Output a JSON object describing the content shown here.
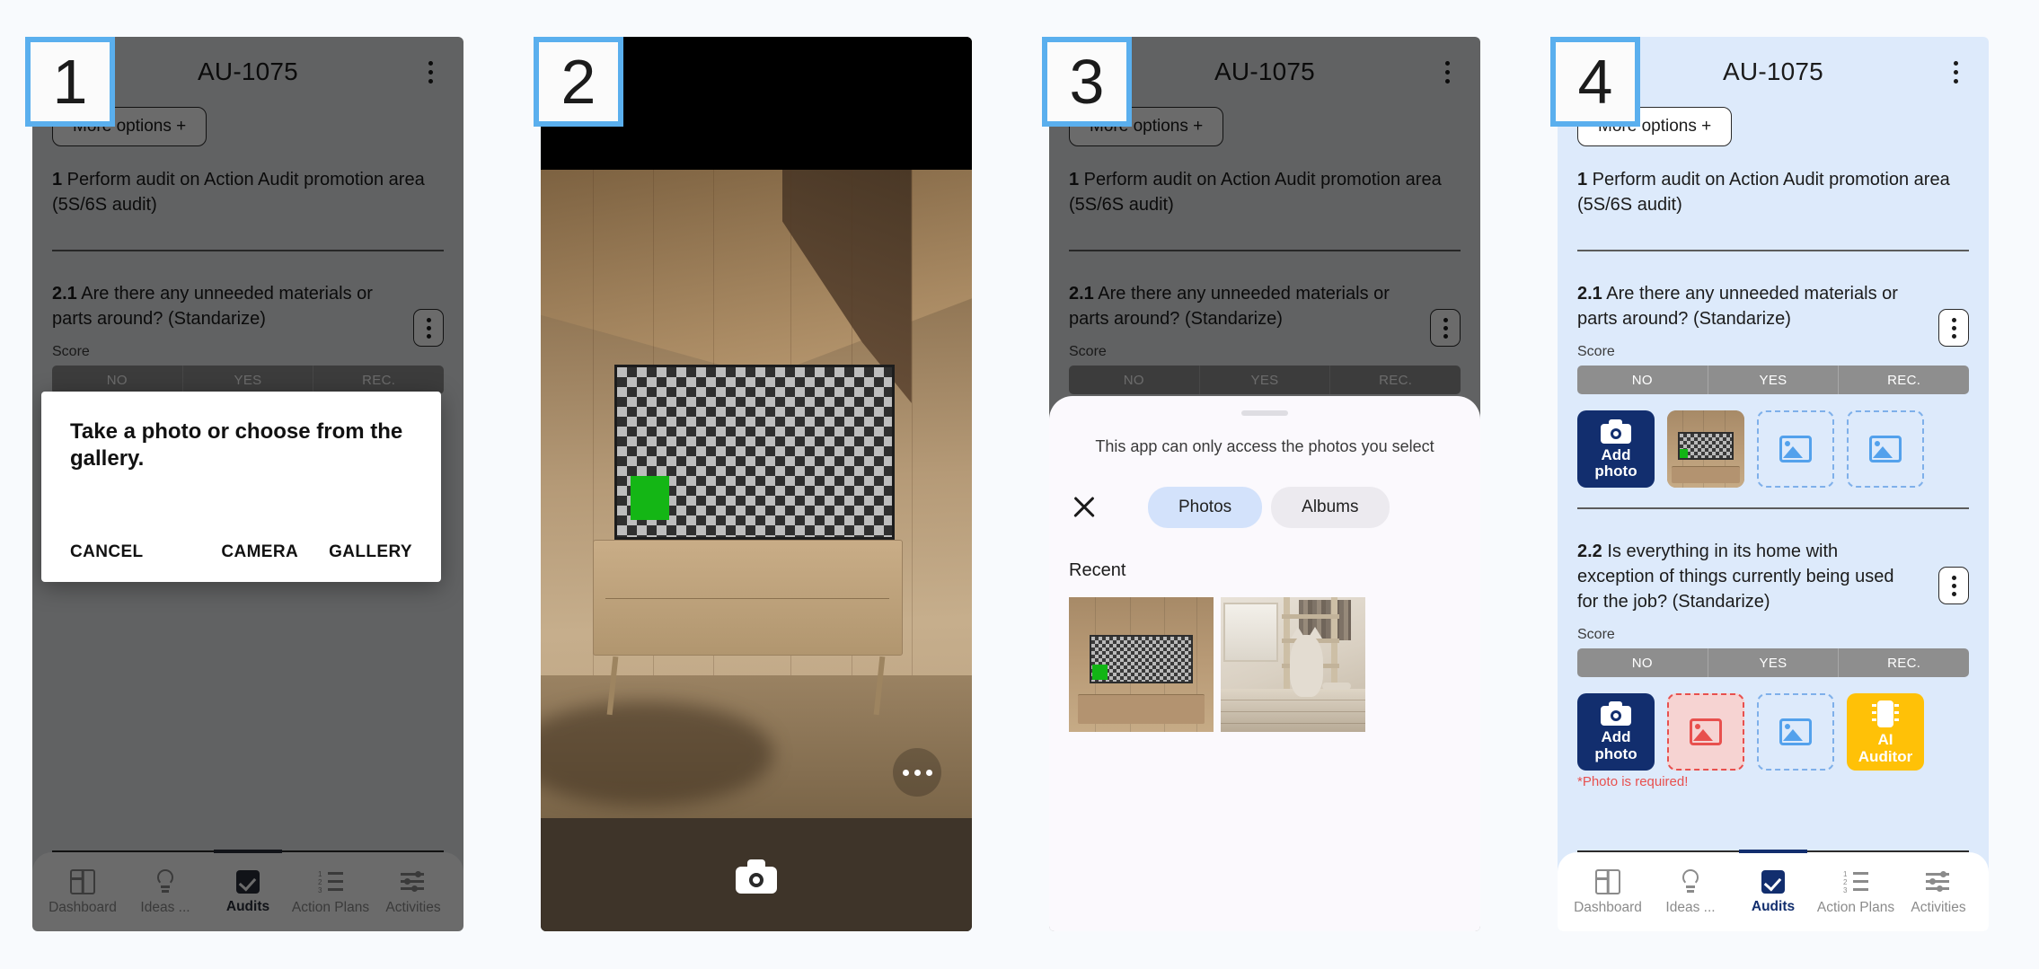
{
  "steps": [
    {
      "number": "1"
    },
    {
      "number": "2"
    },
    {
      "number": "3"
    },
    {
      "number": "4"
    }
  ],
  "app": {
    "title": "AU-1075",
    "more_options_label": "More options +",
    "kebab_icon": "kebab-menu-icon",
    "question_main": {
      "number": "1",
      "text": " Perform audit on Action Audit promotion area (5S/6S audit)"
    },
    "questions": [
      {
        "number": "2.1",
        "text": " Are there any unneeded materials or parts around? (Standarize)",
        "score_label": "Score",
        "score_options": [
          "NO",
          "YES",
          "REC."
        ],
        "photo_required_note": ""
      },
      {
        "number": "2.2",
        "text": " Is everything in its home with exception of things currently being used for the job? (Standarize)",
        "score_label": "Score",
        "score_options": [
          "NO",
          "YES",
          "REC."
        ],
        "photo_required_note": "*Photo is required!"
      }
    ],
    "photo_buttons": {
      "add_photo_label": "Add\nphoto",
      "add_photo_line1": "Add",
      "add_photo_line2": "photo",
      "ai_auditor_line1": "AI",
      "ai_auditor_line2": "Auditor",
      "camera_icon": "camera-icon",
      "image_placeholder_icon": "image-placeholder-icon",
      "ai_chip_icon": "ai-chip-icon"
    },
    "bottom_nav": [
      {
        "label": "Dashboard",
        "icon": "dashboard-icon",
        "active": false
      },
      {
        "label": "Ideas ...",
        "icon": "lightbulb-icon",
        "active": false
      },
      {
        "label": "Audits",
        "icon": "checkbox-icon",
        "active": true
      },
      {
        "label": "Action Plans",
        "icon": "numbered-list-icon",
        "active": false
      },
      {
        "label": "Activities",
        "icon": "sliders-icon",
        "active": false
      }
    ]
  },
  "alert_dialog": {
    "message": "Take a photo or choose from the gallery.",
    "cancel_label": "CANCEL",
    "camera_label": "CAMERA",
    "gallery_label": "GALLERY"
  },
  "camera_screen": {
    "shutter_icon": "camera-shutter-icon",
    "more_icon": "more-dots-icon"
  },
  "photo_picker": {
    "notice": "This app can only access the photos you select",
    "close_icon": "close-x-icon",
    "tabs": [
      {
        "label": "Photos",
        "selected": true
      },
      {
        "label": "Albums",
        "selected": false
      }
    ],
    "section_label": "Recent",
    "thumbnails": [
      {
        "name": "tv-checkerboard-photo"
      },
      {
        "name": "cat-room-photo"
      }
    ]
  },
  "colors": {
    "accent_blue": "#122e6e",
    "page_bg": "#ddeafb",
    "board_bg": "#f8fafd",
    "badge_border": "#5aafee",
    "yellow": "#ffc107",
    "red": "#e8504e",
    "placeholder_blue": "#7fb0ea",
    "score_gray": "#8e8e8e"
  }
}
